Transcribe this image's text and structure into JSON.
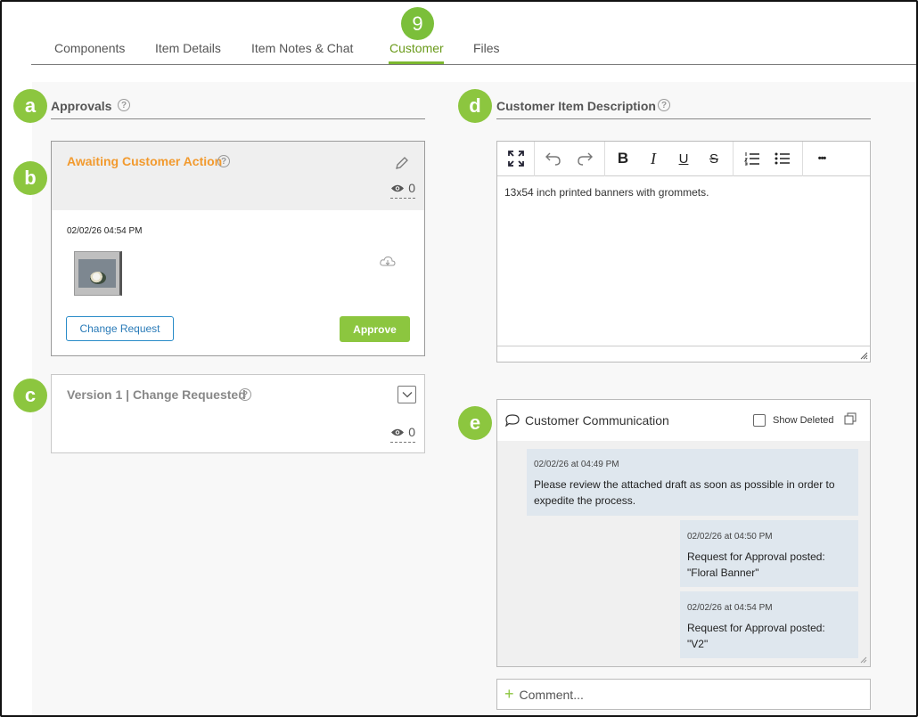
{
  "tabs": {
    "components": "Components",
    "item_details": "Item Details",
    "item_notes": "Item Notes & Chat",
    "customer": "Customer",
    "files": "Files"
  },
  "badges": {
    "step": "9",
    "a": "a",
    "b": "b",
    "c": "c",
    "d": "d",
    "e": "e"
  },
  "approvals": {
    "title": "Approvals",
    "help": "?",
    "current": {
      "status": "Awaiting Customer Action",
      "views": "0",
      "timestamp": "02/02/26 04:54 PM",
      "change_request_label": "Change Request",
      "approve_label": "Approve"
    },
    "previous": {
      "title": "Version 1 | Change Requested",
      "views": "0"
    }
  },
  "description": {
    "title": "Customer Item Description",
    "help": "?",
    "text": "13x54 inch printed banners with grommets.",
    "toolbar": {
      "bold": "B",
      "italic": "I",
      "underline": "U",
      "strike": "S",
      "more": "•••"
    }
  },
  "communication": {
    "title": "Customer Communication",
    "show_deleted_label": "Show Deleted",
    "messages": [
      {
        "time": "02/02/26 at 04:49 PM",
        "line1": "Please review the attached draft as soon as possible in order to",
        "line2": "expedite the process."
      },
      {
        "time": "02/02/26 at 04:50 PM",
        "line1": "Request for Approval posted:",
        "line2": "\"Floral Banner\""
      },
      {
        "time": "02/02/26 at 04:54 PM",
        "line1": "Request for Approval posted:",
        "line2": "\"V2\""
      }
    ],
    "comment_placeholder": "Comment..."
  },
  "colors": {
    "accent_green": "#8cc63f",
    "awaiting_orange": "#f29a2e",
    "link_blue": "#2a8cc8",
    "message_bg": "#dfe7ee"
  }
}
